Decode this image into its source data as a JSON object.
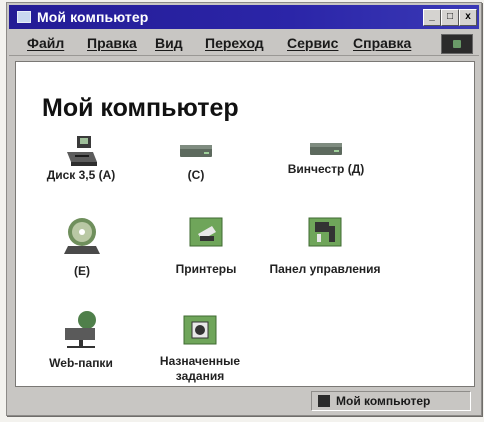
{
  "window": {
    "title": "Мой компьютер",
    "buttons": {
      "minimize": "_",
      "maximize": "□",
      "close": "x"
    }
  },
  "menu": [
    "Файл",
    "Правка",
    "Вид",
    "Переход",
    "Сервис",
    "Справка"
  ],
  "heading": "Мой компьютер",
  "items": {
    "floppy": "Диск 3,5 (А)",
    "drive_c": "(С)",
    "drive_d": "Винчестр (Д)",
    "cdrom": "(Е)",
    "printers": "Принтеры",
    "control_panel": "Панел управления",
    "web_folders": "Web-папки",
    "scheduled_line1": "Назначенные",
    "scheduled_line2": "задания"
  },
  "status": {
    "text": "Мой компьютер"
  },
  "icons": {
    "floppy": "floppy-drive-icon",
    "drive_c": "hard-drive-icon",
    "drive_d": "hard-drive-icon",
    "cdrom": "cd-drive-icon",
    "printers": "printer-folder-icon",
    "control_panel": "control-panel-icon",
    "web_folders": "web-folder-icon",
    "scheduled": "scheduled-tasks-icon"
  },
  "colors": {
    "titlebar": "#2b25a8",
    "folder": "#6fa55a",
    "window": "#c8c6c3"
  }
}
